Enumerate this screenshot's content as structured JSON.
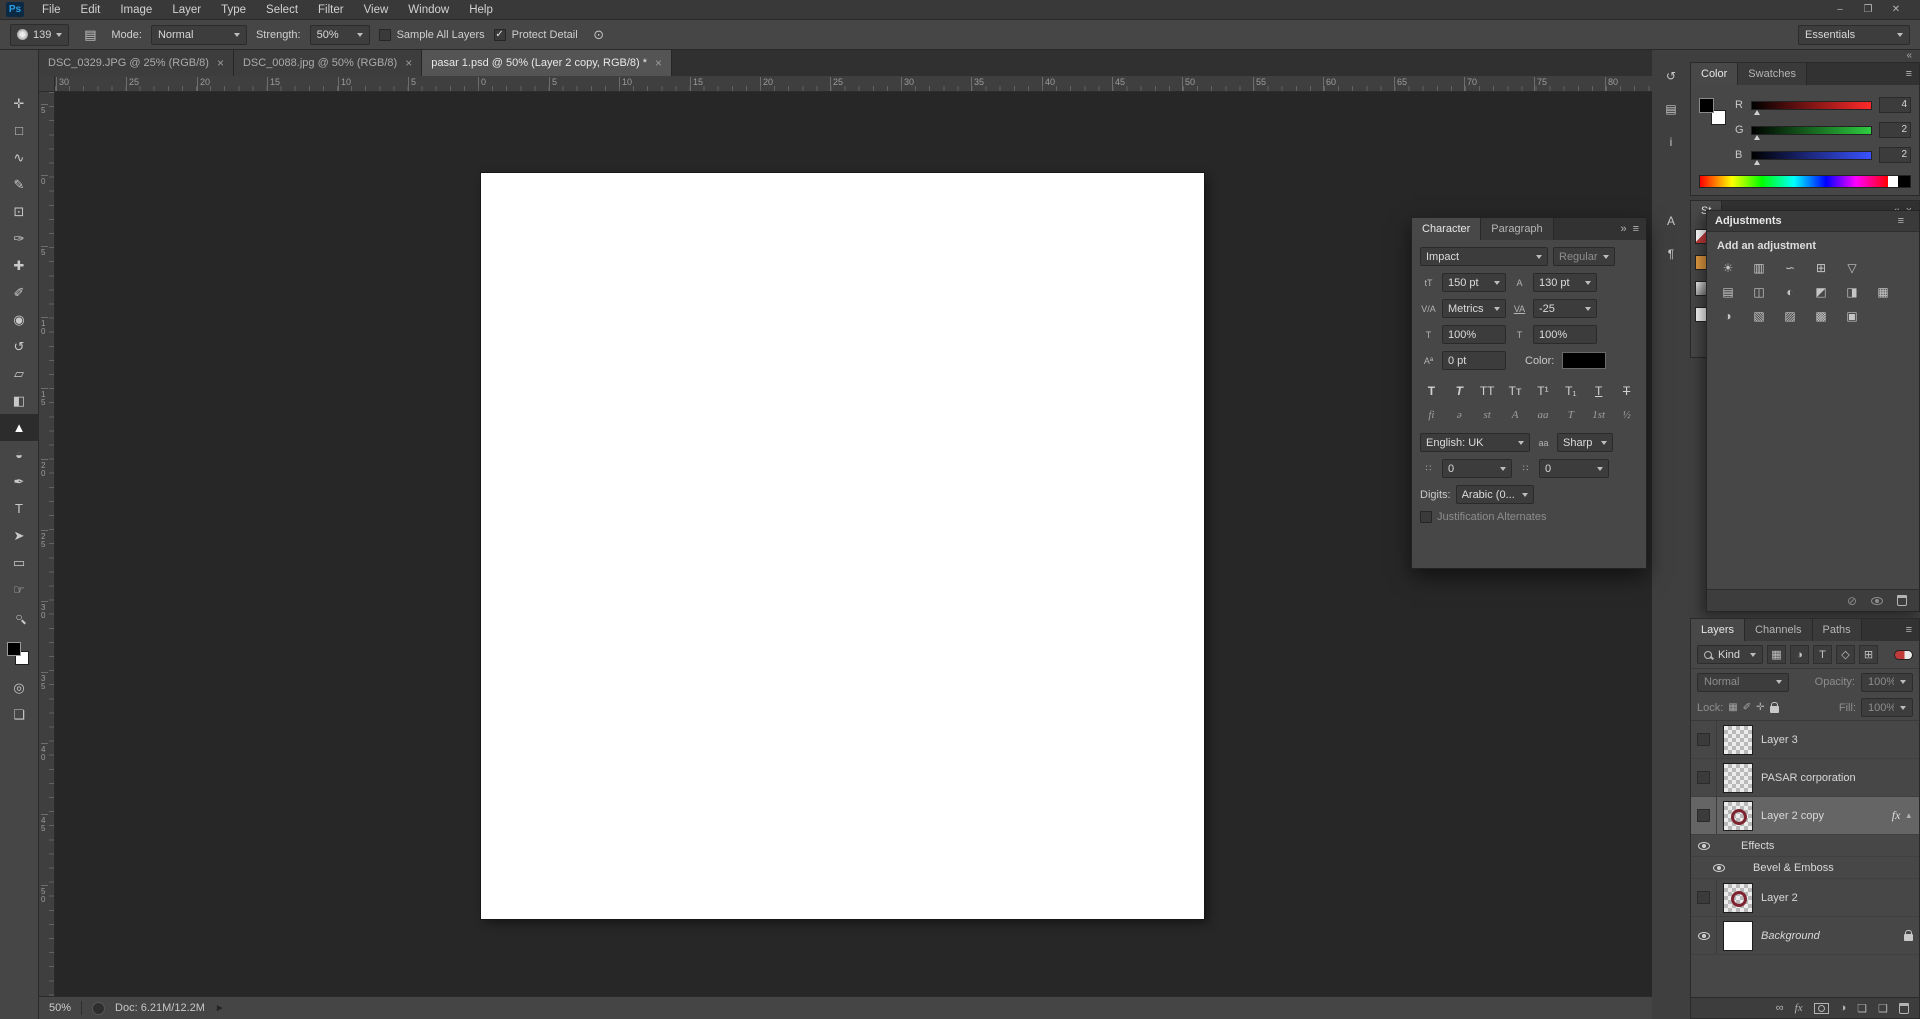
{
  "glyphs": {
    "collapse": "«",
    "expand": "»",
    "panel_menu": "≡",
    "close": "×",
    "arrow_up": "▴",
    "play": "►",
    "check": "✓",
    "airbrush": "⊙",
    "brush_panel": "▤",
    "quick_mask": "◎",
    "screen_mode": "❏"
  },
  "menu_bar": {
    "logo_text": "Ps",
    "items": [
      "File",
      "Edit",
      "Image",
      "Layer",
      "Type",
      "Select",
      "Filter",
      "View",
      "Window",
      "Help"
    ],
    "window_controls": [
      "–",
      "❐",
      "✕"
    ]
  },
  "options_bar": {
    "brush_size": "139",
    "mode_label": "Mode:",
    "mode_value": "Normal",
    "strength_label": "Strength:",
    "strength_value": "50%",
    "sample_all_layers": "Sample All Layers",
    "protect_detail": "Protect Detail",
    "workspace": "Essentials"
  },
  "document_tabs": [
    {
      "title": "DSC_0329.JPG @ 25% (RGB/8)",
      "close": "×"
    },
    {
      "title": "DSC_0088.jpg @ 50% (RGB/8)",
      "close": "×"
    },
    {
      "title": "pasar 1.psd @ 50% (Layer 2 copy, RGB/8) *",
      "close": "×"
    }
  ],
  "toolbar": {
    "tools": [
      {
        "name": "move",
        "glyph": "✛"
      },
      {
        "name": "marquee",
        "glyph": "□"
      },
      {
        "name": "lasso",
        "glyph": "∿"
      },
      {
        "name": "quick-selection",
        "glyph": "✎"
      },
      {
        "name": "crop",
        "glyph": "⊡"
      },
      {
        "name": "eyedropper",
        "glyph": "✑"
      },
      {
        "name": "healing-brush",
        "glyph": "✚"
      },
      {
        "name": "brush",
        "glyph": "✐"
      },
      {
        "name": "clone-stamp",
        "glyph": "◉"
      },
      {
        "name": "history-brush",
        "glyph": "↺"
      },
      {
        "name": "eraser",
        "glyph": "▱"
      },
      {
        "name": "gradient",
        "glyph": "◧"
      },
      {
        "name": "sharpen",
        "glyph": "▲"
      },
      {
        "name": "dodge",
        "glyph": "◒"
      },
      {
        "name": "pen",
        "glyph": "✒"
      },
      {
        "name": "type",
        "glyph": "T"
      },
      {
        "name": "path-selection",
        "glyph": "➤"
      },
      {
        "name": "shape",
        "glyph": "▭"
      },
      {
        "name": "hand",
        "glyph": "☞"
      },
      {
        "name": "zoom",
        "glyph": "○"
      }
    ]
  },
  "rulers": {
    "horizontal": [
      "30",
      "25",
      "20",
      "15",
      "10",
      "5",
      "0",
      "5",
      "10",
      "15",
      "20",
      "25",
      "30",
      "35",
      "40",
      "45",
      "50",
      "55",
      "60",
      "65",
      "70",
      "75",
      "80"
    ],
    "vertical": [
      "5",
      "0",
      "5",
      "10",
      "15",
      "20",
      "25",
      "30",
      "35",
      "40",
      "45",
      "50"
    ]
  },
  "status_bar": {
    "zoom": "50%",
    "doc_info": "Doc: 6.21M/12.2M"
  },
  "panel_strip": {
    "icons": [
      {
        "name": "history",
        "glyph": "↺"
      },
      {
        "name": "properties",
        "glyph": "▤"
      },
      {
        "name": "info",
        "glyph": "i"
      },
      {
        "name": "character",
        "glyph": "A"
      },
      {
        "name": "paragraph",
        "glyph": "¶"
      }
    ]
  },
  "color_panel": {
    "tabs": [
      "Color",
      "Swatches"
    ],
    "channels": [
      {
        "label": "R",
        "value": "4"
      },
      {
        "label": "G",
        "value": "2"
      },
      {
        "label": "B",
        "value": "2"
      }
    ]
  },
  "styles_panel": {
    "tab": "St"
  },
  "adjustments_panel": {
    "tab": "Adjustments",
    "title": "Add an adjustment",
    "rows": [
      [
        "☀",
        "▥",
        "∽",
        "⊞",
        "▽"
      ],
      [
        "▤",
        "◫",
        "◐",
        "◩",
        "◨",
        "▦"
      ],
      [
        "◑",
        "▧",
        "▨",
        "▩",
        "▣"
      ]
    ],
    "footer_icon": "⊘"
  },
  "character_panel": {
    "tabs": [
      "Character",
      "Paragraph"
    ],
    "font_family": "Impact",
    "font_style": "Regular",
    "size_value": "150 pt",
    "leading_value": "130 pt",
    "kerning_value": "Metrics",
    "tracking_value": "-25",
    "vertical_scale": "100%",
    "horizontal_scale": "100%",
    "baseline_shift": "0 pt",
    "color_label": "Color:",
    "style_buttons": [
      "T",
      "T",
      "TT",
      "Tᴛ",
      "T¹",
      "T₁",
      "T",
      "T"
    ],
    "opentype_buttons": [
      "fi",
      "ə",
      "st",
      "A",
      "aa",
      "T",
      "1st",
      "½"
    ],
    "language_value": "English: UK",
    "antialias_icon": "aa",
    "antialias_value": "Sharp",
    "extra_left": "0",
    "extra_right": "0",
    "digits_label": "Digits:",
    "digits_value": "Arabic (0...",
    "justification_label": "Justification Alternates",
    "icons": {
      "size": "tT",
      "leading": "A",
      "kerning": "V/A",
      "tracking": "VA",
      "vscale": "T",
      "hscale": "T",
      "baseline": "Aª",
      "me1": "∷",
      "me2": "∷"
    }
  },
  "layers_panel": {
    "tabs": [
      "Layers",
      "Channels",
      "Paths"
    ],
    "filter_label": "Kind",
    "filter_icons": [
      "▦",
      "◑",
      "T",
      "◇",
      "⊞"
    ],
    "blend_mode": "Normal",
    "opacity_label": "Opacity:",
    "opacity_value": "100%",
    "lock_label": "Lock:",
    "lock_icons": [
      "▦",
      "✐",
      "✛"
    ],
    "fill_label": "Fill:",
    "fill_value": "100%",
    "layers": [
      {
        "name": "Layer 3"
      },
      {
        "name": "PASAR corporation"
      },
      {
        "name": "Layer 2 copy",
        "fx_badge": "fx"
      },
      {
        "name": "Effects"
      },
      {
        "name": "Bevel & Emboss"
      },
      {
        "name": "Layer 2"
      },
      {
        "name": "Background"
      }
    ],
    "footer_icons": [
      "∞",
      "fx",
      "◑",
      "❏",
      "❑"
    ]
  }
}
